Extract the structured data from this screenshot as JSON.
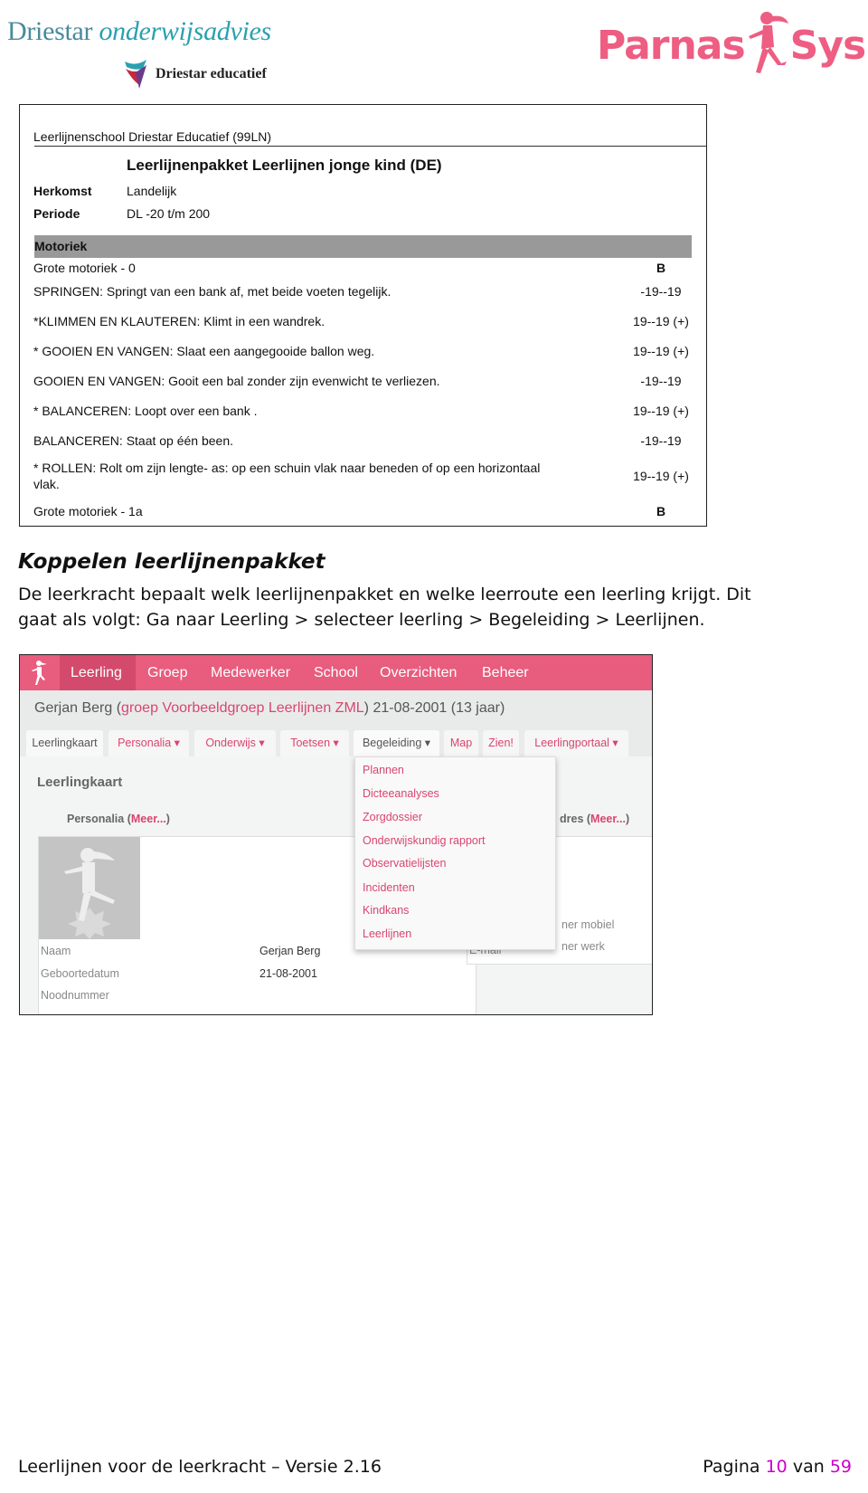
{
  "header": {
    "brand_main": "Driestar",
    "brand_italic": "onderwijsadvies",
    "brand_sub": "Driestar educatief",
    "parnas_left": "Parnas",
    "parnas_right": "Sys"
  },
  "report": {
    "school": "Leerlijnenschool Driestar Educatief (99LN)",
    "title": "Leerlijnenpakket Leerlijnen jonge kind (DE)",
    "herkomst_label": "Herkomst",
    "herkomst_value": "Landelijk",
    "periode_label": "Periode",
    "periode_value": "DL -20 t/m 200",
    "section": "Motoriek",
    "rows": [
      {
        "text": "Grote motoriek - 0",
        "value": "B"
      },
      {
        "text": "SPRINGEN: Springt van een bank af, met beide voeten tegelijk.",
        "value": "-19--19"
      },
      {
        "text": "*KLIMMEN EN KLAUTEREN: Klimt in een wandrek.",
        "value": "19--19 (+)"
      },
      {
        "text": "* GOOIEN EN VANGEN: Slaat een aangegooide ballon weg.",
        "value": "19--19 (+)"
      },
      {
        "text": "GOOIEN EN VANGEN: Gooit een bal zonder zijn evenwicht te verliezen.",
        "value": "-19--19"
      },
      {
        "text": "* BALANCEREN: Loopt over een bank .",
        "value": "19--19 (+)"
      },
      {
        "text": "BALANCEREN: Staat op één been.",
        "value": "-19--19"
      },
      {
        "text": "* ROLLEN: Rolt  om zijn lengte- as: op een schuin vlak naar beneden of op een horizontaal",
        "text2": "vlak.",
        "value": "19--19 (+)"
      },
      {
        "text": "Grote motoriek - 1a",
        "value": "B"
      }
    ]
  },
  "section": {
    "heading": "Koppelen leerlijnenpakket",
    "line1": "De leerkracht bepaalt welk leerlijnenpakket en welke leerroute een leerling krijgt. Dit",
    "line2": "gaat als volgt: Ga naar Leerling > selecteer leerling > Begeleiding > Leerlijnen."
  },
  "app": {
    "nav": [
      "Leerling",
      "Groep",
      "Medewerker",
      "School",
      "Overzichten",
      "Beheer"
    ],
    "student_name": "Gerjan Berg (",
    "student_group": "groep Voorbeeldgroep Leerlijnen ZML",
    "student_rest": ") 21-08-2001 (13 jaar)",
    "tabs": [
      "Leerlingkaart",
      "Personalia ▾",
      "Onderwijs ▾",
      "Toetsen ▾",
      "Begeleiding ▾",
      "Map",
      "Zien!",
      "Leerlingportaal ▾"
    ],
    "page_title": "Leerlingkaart",
    "personalia": "Personalia (",
    "meer": "Meer...",
    "close": ")",
    "adres": "dres (",
    "fields": [
      {
        "label": "Naam",
        "value": "Gerjan Berg"
      },
      {
        "label": "Geboortedatum",
        "value": "21-08-2001"
      },
      {
        "label": "Noodnummer",
        "value": ""
      }
    ],
    "right_fields": [
      "ner mobiel",
      "ner werk",
      "E-mail"
    ],
    "dropdown": [
      "Plannen",
      "Dicteeanalyses",
      "Zorgdossier",
      "Onderwijskundig rapport",
      "Observatielijsten",
      "Incidenten",
      "Kindkans",
      "Leerlijnen"
    ],
    "accent": "#e85c7e"
  },
  "footer": {
    "doc": "Leerlijnen voor de leerkracht – Versie 2.16",
    "page_label": "Pagina",
    "page": "10",
    "of": "van",
    "total": "59"
  }
}
